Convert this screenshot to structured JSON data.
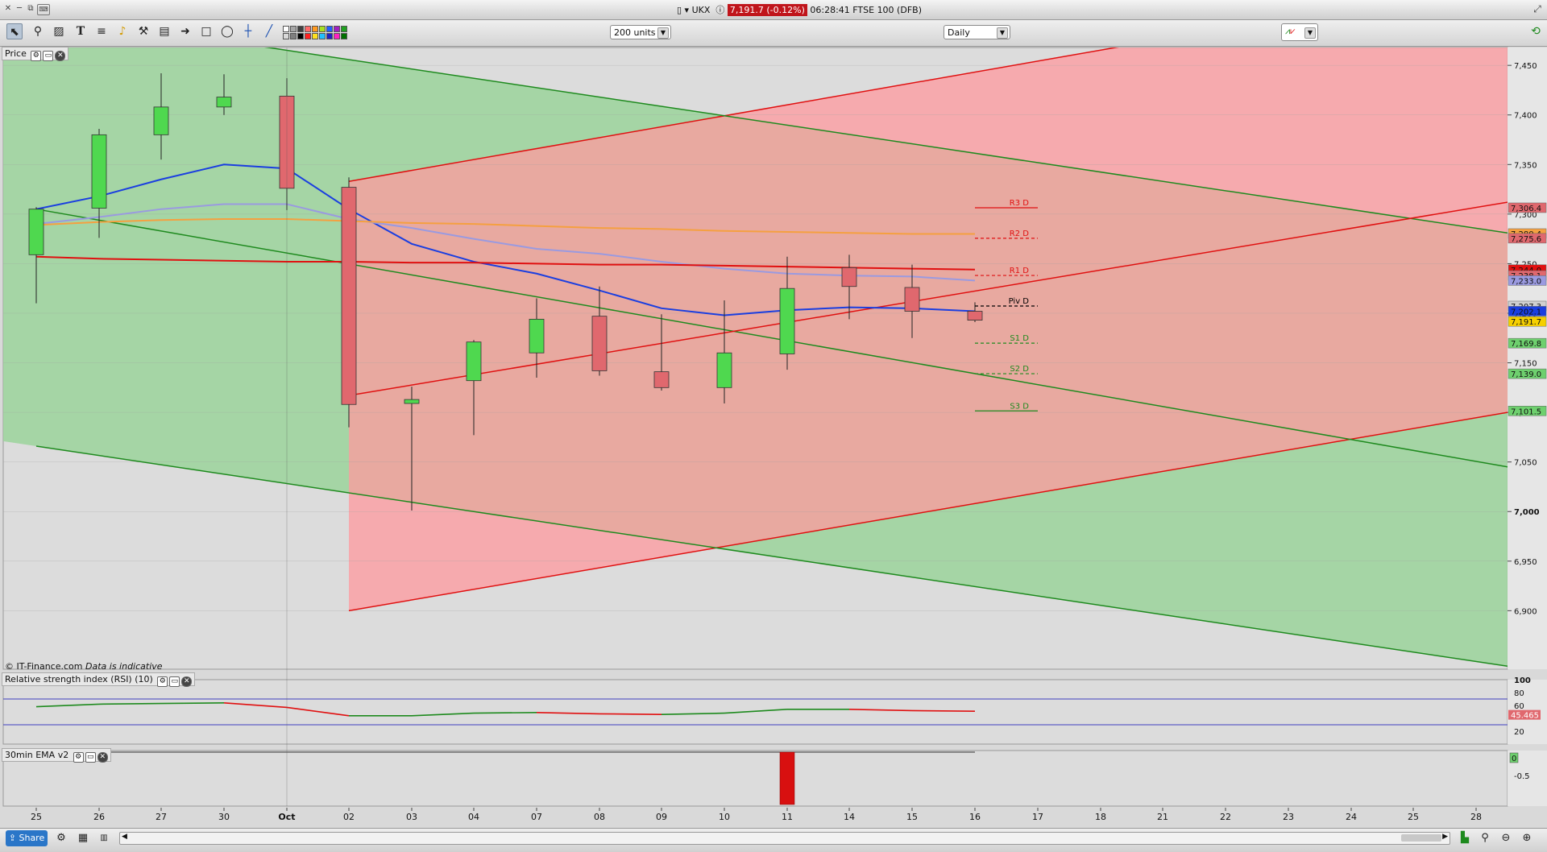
{
  "title_bar": {
    "symbol": "UKX",
    "price_badge": "7,191.7 (-0.12%)",
    "time": "06:28:41",
    "market": "FTSE 100 (DFB)"
  },
  "toolbar": {
    "tools": [
      "pointer-icon",
      "magnifier-icon",
      "fib-icon",
      "text-icon",
      "trendlines-icon",
      "alert-icon",
      "hammer-icon",
      "trash-icon",
      "arrow-icon",
      "rectangle-icon",
      "ellipse-icon",
      "crosshair-icon",
      "pencil-icon"
    ],
    "swatches": [
      "#ffffff",
      "#d9d9d9",
      "#a6a6a6",
      "#7f7f7f",
      "#404040",
      "#000000",
      "#ff6a6a",
      "#ff2020",
      "#ff9a20",
      "#ffe020",
      "#a6e020",
      "#20c0ff",
      "#2060ff",
      "#2020c0",
      "#a020c0",
      "#ff20c0",
      "#20a020",
      "#007000"
    ],
    "units_select": "200 units",
    "period_select": "Daily"
  },
  "colors": {
    "bull": "#4fd84f",
    "bear": "#e0686e",
    "red_line": "#e01010",
    "green_line": "#1e8a1e",
    "blue_line": "#1a3ee0",
    "lavender_line": "#9a9ae0",
    "orange_line": "#f5a040",
    "red_zone": "#ff9a9f",
    "green_zone": "#9bd39b",
    "overlap_zone": "#b88a78"
  },
  "panels": {
    "price": {
      "title": "Price",
      "watermark": "© IT-Finance.com",
      "watermark_note": "Data is indicative"
    },
    "rsi": {
      "title": "Relative strength index (RSI) (10)",
      "value_label": "45.465"
    },
    "ema": {
      "title": "30min EMA v2",
      "value_label": "0",
      "tick": "-0.5"
    }
  },
  "chart_data": [
    {
      "type": "candlestick",
      "title": "Price",
      "x_labels": [
        "25",
        "26",
        "27",
        "30",
        "Oct",
        "02",
        "03",
        "04",
        "07",
        "08",
        "09",
        "10",
        "11",
        "14",
        "15",
        "16",
        "17",
        "18",
        "21",
        "22",
        "23",
        "24",
        "25",
        "28"
      ],
      "y_ticks": [
        6900,
        6950,
        7000,
        7050,
        7100,
        7150,
        7200,
        7250,
        7300,
        7350,
        7400,
        7450
      ],
      "y_tick_labels": [
        "6,900",
        "6,950",
        "7,000",
        "7,050",
        "7,100",
        "7,150",
        "7,200",
        "7,250",
        "7,300",
        "7,350",
        "7,400",
        "7,450"
      ],
      "ylim": [
        6841,
        7468
      ],
      "candles": [
        {
          "x": "25",
          "o": 7259,
          "h": 7307,
          "l": 7210,
          "c": 7305
        },
        {
          "x": "26",
          "o": 7306,
          "h": 7386,
          "l": 7276,
          "c": 7380
        },
        {
          "x": "27",
          "o": 7380,
          "h": 7442,
          "l": 7355,
          "c": 7408
        },
        {
          "x": "30",
          "o": 7408,
          "h": 7441,
          "l": 7400,
          "c": 7418
        },
        {
          "x": "Oct",
          "o": 7419,
          "h": 7437,
          "l": 7304,
          "c": 7326
        },
        {
          "x": "02",
          "o": 7327,
          "h": 7337,
          "l": 7085,
          "c": 7108
        },
        {
          "x": "03",
          "o": 7109,
          "h": 7126,
          "l": 7001,
          "c": 7113
        },
        {
          "x": "04",
          "o": 7132,
          "h": 7173,
          "l": 7077,
          "c": 7171
        },
        {
          "x": "07",
          "o": 7160,
          "h": 7215,
          "l": 7135,
          "c": 7194
        },
        {
          "x": "08",
          "o": 7197,
          "h": 7227,
          "l": 7137,
          "c": 7142
        },
        {
          "x": "09",
          "o": 7141,
          "h": 7199,
          "l": 7122,
          "c": 7125
        },
        {
          "x": "10",
          "o": 7125,
          "h": 7213,
          "l": 7109,
          "c": 7160
        },
        {
          "x": "11",
          "o": 7159,
          "h": 7257,
          "l": 7143,
          "c": 7225
        },
        {
          "x": "14",
          "o": 7246,
          "h": 7259,
          "l": 7194,
          "c": 7227
        },
        {
          "x": "15",
          "o": 7226,
          "h": 7249,
          "l": 7175,
          "c": 7202
        },
        {
          "x": "16",
          "o": 7202,
          "h": 7211,
          "l": 7191,
          "c": 7193
        }
      ],
      "series": [
        {
          "color": "#1a3ee0",
          "points": [
            [
              "25",
              7305
            ],
            [
              "26",
              7318
            ],
            [
              "27",
              7335
            ],
            [
              "30",
              7350
            ],
            [
              "Oct",
              7346
            ],
            [
              "02",
              7305
            ],
            [
              "03",
              7270
            ],
            [
              "04",
              7252
            ],
            [
              "07",
              7240
            ],
            [
              "08",
              7223
            ],
            [
              "09",
              7205
            ],
            [
              "10",
              7198
            ],
            [
              "11",
              7203
            ],
            [
              "14",
              7206
            ],
            [
              "15",
              7205
            ],
            [
              "16",
              7202
            ]
          ]
        },
        {
          "color": "#9a9ae0",
          "points": [
            [
              "25",
              7290
            ],
            [
              "26",
              7297
            ],
            [
              "27",
              7305
            ],
            [
              "30",
              7310
            ],
            [
              "Oct",
              7310
            ],
            [
              "02",
              7295
            ],
            [
              "03",
              7286
            ],
            [
              "04",
              7275
            ],
            [
              "07",
              7265
            ],
            [
              "08",
              7260
            ],
            [
              "09",
              7252
            ],
            [
              "10",
              7245
            ],
            [
              "11",
              7240
            ],
            [
              "14",
              7238
            ],
            [
              "15",
              7237
            ],
            [
              "16",
              7233
            ]
          ]
        },
        {
          "color": "#f5a040",
          "points": [
            [
              "25",
              7289
            ],
            [
              "26",
              7292
            ],
            [
              "27",
              7294
            ],
            [
              "30",
              7295
            ],
            [
              "Oct",
              7295
            ],
            [
              "02",
              7293
            ],
            [
              "03",
              7291
            ],
            [
              "04",
              7290
            ],
            [
              "07",
              7288
            ],
            [
              "08",
              7286
            ],
            [
              "09",
              7285
            ],
            [
              "10",
              7283
            ],
            [
              "11",
              7282
            ],
            [
              "14",
              7281
            ],
            [
              "15",
              7280
            ],
            [
              "16",
              7280
            ]
          ]
        },
        {
          "color": "#e01010",
          "points": [
            [
              "25",
              7257
            ],
            [
              "26",
              7255
            ],
            [
              "27",
              7254
            ],
            [
              "30",
              7253
            ],
            [
              "Oct",
              7252
            ],
            [
              "02",
              7252
            ],
            [
              "03",
              7251
            ],
            [
              "04",
              7251
            ],
            [
              "07",
              7250
            ],
            [
              "08",
              7249
            ],
            [
              "09",
              7249
            ],
            [
              "10",
              7248
            ],
            [
              "11",
              7247
            ],
            [
              "14",
              7246
            ],
            [
              "15",
              7245
            ],
            [
              "16",
              7244
            ]
          ]
        }
      ],
      "pivots": [
        {
          "label": "R3 D",
          "value": 7306.4,
          "color": "#e01010",
          "style": "solid"
        },
        {
          "label": "R2 D",
          "value": 7275.6,
          "color": "#e01010",
          "style": "dashed"
        },
        {
          "label": "R1 D",
          "value": 7238.1,
          "color": "#e01010",
          "style": "dashed"
        },
        {
          "label": "Piv D",
          "value": 7207.3,
          "color": "#000000",
          "style": "dashed"
        },
        {
          "label": "S1 D",
          "value": 7169.8,
          "color": "#1e8a1e",
          "style": "dashed"
        },
        {
          "label": "S2 D",
          "value": 7139.0,
          "color": "#1e8a1e",
          "style": "dashed"
        },
        {
          "label": "S3 D",
          "value": 7101.5,
          "color": "#1e8a1e",
          "style": "solid"
        }
      ],
      "right_labels": [
        {
          "text": "7,306.4",
          "value": 7306.4,
          "bg": "#e0686e"
        },
        {
          "text": "7,280.4",
          "value": 7280.4,
          "bg": "#f5a040"
        },
        {
          "text": "7,275.6",
          "value": 7275.6,
          "bg": "#e0686e"
        },
        {
          "text": "7,244.0",
          "value": 7244.0,
          "bg": "#e01010"
        },
        {
          "text": "7,238.1",
          "value": 7238.1,
          "bg": "#e0686e"
        },
        {
          "text": "7,233.0",
          "value": 7233.0,
          "bg": "#9a9ae0"
        },
        {
          "text": "7,207.3",
          "value": 7207.3,
          "bg": "#d0d0d0"
        },
        {
          "text": "7,202.1",
          "value": 7202.1,
          "bg": "#1a3ee0"
        },
        {
          "text": "7,191.7",
          "value": 7191.7,
          "bg": "#f5d000"
        },
        {
          "text": "7,169.8",
          "value": 7169.8,
          "bg": "#6ed06e"
        },
        {
          "text": "7,139.0",
          "value": 7139.0,
          "bg": "#6ed06e"
        },
        {
          "text": "7,101.5",
          "value": 7101.5,
          "bg": "#6ed06e"
        }
      ],
      "trend_channels": [
        {
          "color": "#e01010",
          "upper": [
            [
              "02",
              7333
            ],
            [
              "28+",
              7537
            ]
          ],
          "lower": [
            [
              "02",
              6900
            ],
            [
              "28+",
              7100
            ]
          ]
        },
        {
          "color": "#1e8a1e",
          "upper": [
            [
              "25",
              7503
            ],
            [
              "28+",
              7281
            ]
          ],
          "lower": [
            [
              "25",
              7066
            ],
            [
              "28+",
              6844
            ]
          ]
        },
        {
          "color": "#1e8a1e",
          "mid": [
            [
              "25",
              7305
            ],
            [
              "28+",
              7045
            ]
          ]
        },
        {
          "color": "#e01010",
          "mid": [
            [
              "02",
              7117
            ],
            [
              "28+",
              7312
            ]
          ]
        }
      ]
    },
    {
      "type": "line",
      "title": "Relative strength index (RSI) (10)",
      "y_ticks": [
        20,
        60,
        80,
        100
      ],
      "ylim": [
        0,
        100
      ],
      "levels": [
        30,
        70
      ],
      "x": [
        "25",
        "26",
        "27",
        "30",
        "Oct",
        "02",
        "03",
        "04",
        "07",
        "08",
        "09",
        "10",
        "11",
        "14",
        "15",
        "16"
      ],
      "values": [
        58,
        62,
        63,
        64,
        57,
        44,
        44,
        48,
        49,
        47,
        46,
        48,
        54,
        54,
        52,
        51
      ],
      "last": 45.465
    },
    {
      "type": "bar",
      "title": "30min EMA v2",
      "y_ticks": [
        -0.5
      ],
      "x": [
        "11"
      ],
      "values": [
        -1
      ]
    }
  ],
  "status": {
    "share_label": "Share"
  }
}
